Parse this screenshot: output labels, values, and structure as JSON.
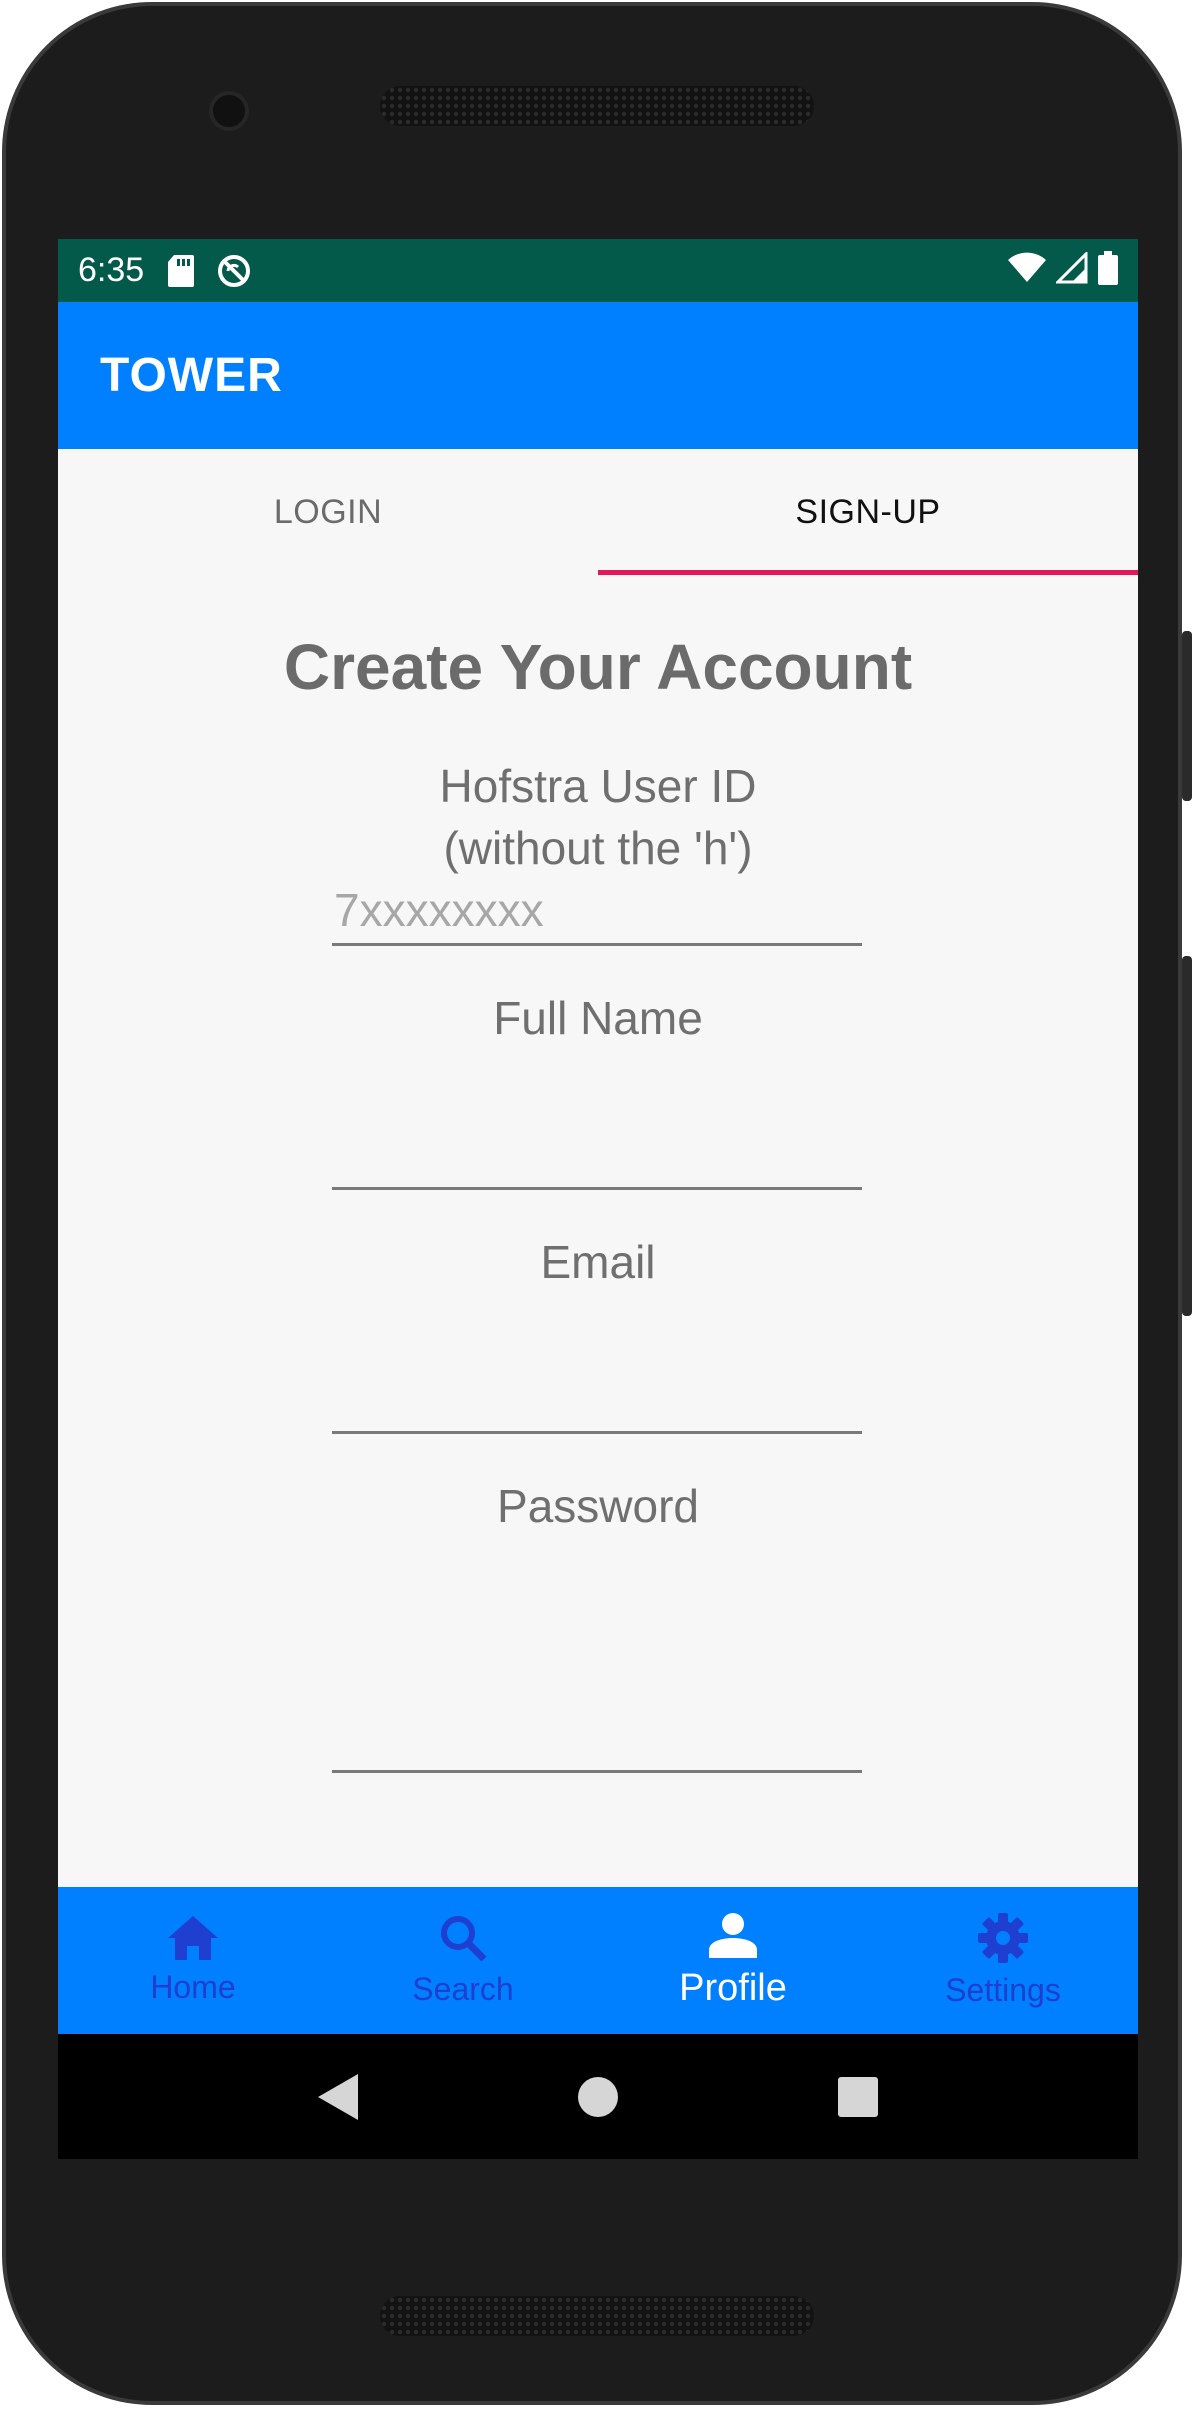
{
  "status_bar": {
    "time": "6:35",
    "icons": [
      "sd-card-icon",
      "sync-disabled-icon",
      "wifi-icon",
      "signal-icon",
      "battery-icon"
    ]
  },
  "app_bar": {
    "title": "TOWER"
  },
  "tabs": [
    {
      "label": "LOGIN",
      "active": false
    },
    {
      "label": "SIGN-UP",
      "active": true
    }
  ],
  "form": {
    "heading": "Create Your Account",
    "user_id": {
      "label_line1": "Hofstra User ID",
      "label_line2": "(without the 'h')",
      "placeholder": "7xxxxxxxx",
      "value": ""
    },
    "full_name": {
      "label": "Full Name",
      "value": ""
    },
    "email": {
      "label": "Email",
      "value": ""
    },
    "password": {
      "label": "Password",
      "value": ""
    }
  },
  "bottom_nav": [
    {
      "label": "Home",
      "icon": "home-icon",
      "active": false
    },
    {
      "label": "Search",
      "icon": "search-icon",
      "active": false
    },
    {
      "label": "Profile",
      "icon": "person-icon",
      "active": true
    },
    {
      "label": "Settings",
      "icon": "gear-icon",
      "active": false
    }
  ],
  "colors": {
    "status_bar": "#03594a",
    "app_bar": "#0080ff",
    "tab_indicator": "#e0195a",
    "nav_inactive": "#1f3fd0"
  }
}
